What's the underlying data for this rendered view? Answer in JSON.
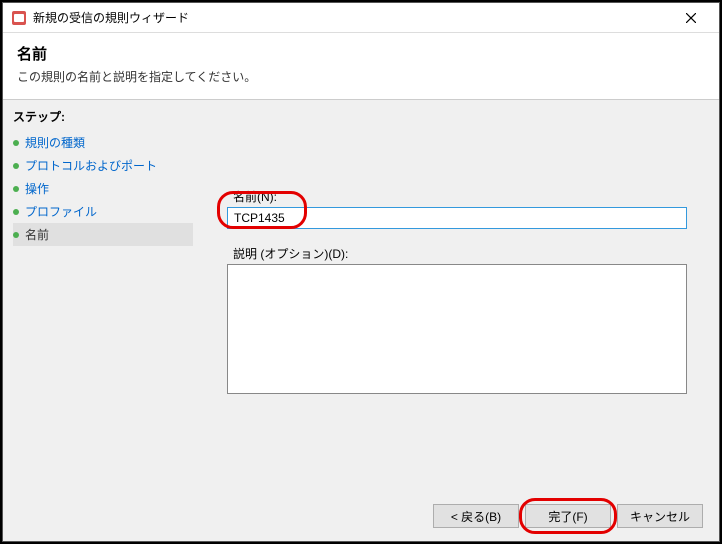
{
  "titlebar": {
    "title": "新規の受信の規則ウィザード"
  },
  "header": {
    "title": "名前",
    "description": "この規則の名前と説明を指定してください。"
  },
  "sidebar": {
    "heading": "ステップ:",
    "items": [
      {
        "label": "規則の種類"
      },
      {
        "label": "プロトコルおよびポート"
      },
      {
        "label": "操作"
      },
      {
        "label": "プロファイル"
      },
      {
        "label": "名前"
      }
    ]
  },
  "form": {
    "name_label": "名前(N):",
    "name_value": "TCP1435",
    "desc_label": "説明 (オプション)(D):",
    "desc_value": ""
  },
  "footer": {
    "back": "< 戻る(B)",
    "finish": "完了(F)",
    "cancel": "キャンセル"
  }
}
